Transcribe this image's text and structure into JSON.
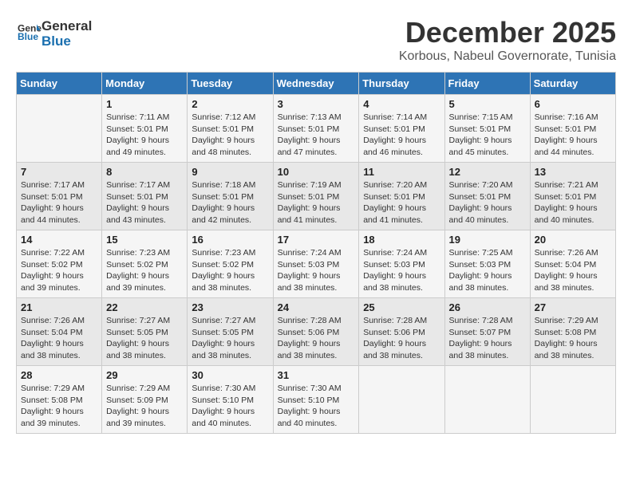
{
  "logo": {
    "general": "General",
    "blue": "Blue"
  },
  "title": {
    "month": "December 2025",
    "location": "Korbous, Nabeul Governorate, Tunisia"
  },
  "headers": [
    "Sunday",
    "Monday",
    "Tuesday",
    "Wednesday",
    "Thursday",
    "Friday",
    "Saturday"
  ],
  "weeks": [
    [
      {
        "day": "",
        "info": ""
      },
      {
        "day": "1",
        "info": "Sunrise: 7:11 AM\nSunset: 5:01 PM\nDaylight: 9 hours and 49 minutes."
      },
      {
        "day": "2",
        "info": "Sunrise: 7:12 AM\nSunset: 5:01 PM\nDaylight: 9 hours and 48 minutes."
      },
      {
        "day": "3",
        "info": "Sunrise: 7:13 AM\nSunset: 5:01 PM\nDaylight: 9 hours and 47 minutes."
      },
      {
        "day": "4",
        "info": "Sunrise: 7:14 AM\nSunset: 5:01 PM\nDaylight: 9 hours and 46 minutes."
      },
      {
        "day": "5",
        "info": "Sunrise: 7:15 AM\nSunset: 5:01 PM\nDaylight: 9 hours and 45 minutes."
      },
      {
        "day": "6",
        "info": "Sunrise: 7:16 AM\nSunset: 5:01 PM\nDaylight: 9 hours and 44 minutes."
      }
    ],
    [
      {
        "day": "7",
        "info": "Sunrise: 7:17 AM\nSunset: 5:01 PM\nDaylight: 9 hours and 44 minutes."
      },
      {
        "day": "8",
        "info": "Sunrise: 7:17 AM\nSunset: 5:01 PM\nDaylight: 9 hours and 43 minutes."
      },
      {
        "day": "9",
        "info": "Sunrise: 7:18 AM\nSunset: 5:01 PM\nDaylight: 9 hours and 42 minutes."
      },
      {
        "day": "10",
        "info": "Sunrise: 7:19 AM\nSunset: 5:01 PM\nDaylight: 9 hours and 41 minutes."
      },
      {
        "day": "11",
        "info": "Sunrise: 7:20 AM\nSunset: 5:01 PM\nDaylight: 9 hours and 41 minutes."
      },
      {
        "day": "12",
        "info": "Sunrise: 7:20 AM\nSunset: 5:01 PM\nDaylight: 9 hours and 40 minutes."
      },
      {
        "day": "13",
        "info": "Sunrise: 7:21 AM\nSunset: 5:01 PM\nDaylight: 9 hours and 40 minutes."
      }
    ],
    [
      {
        "day": "14",
        "info": "Sunrise: 7:22 AM\nSunset: 5:02 PM\nDaylight: 9 hours and 39 minutes."
      },
      {
        "day": "15",
        "info": "Sunrise: 7:23 AM\nSunset: 5:02 PM\nDaylight: 9 hours and 39 minutes."
      },
      {
        "day": "16",
        "info": "Sunrise: 7:23 AM\nSunset: 5:02 PM\nDaylight: 9 hours and 38 minutes."
      },
      {
        "day": "17",
        "info": "Sunrise: 7:24 AM\nSunset: 5:03 PM\nDaylight: 9 hours and 38 minutes."
      },
      {
        "day": "18",
        "info": "Sunrise: 7:24 AM\nSunset: 5:03 PM\nDaylight: 9 hours and 38 minutes."
      },
      {
        "day": "19",
        "info": "Sunrise: 7:25 AM\nSunset: 5:03 PM\nDaylight: 9 hours and 38 minutes."
      },
      {
        "day": "20",
        "info": "Sunrise: 7:26 AM\nSunset: 5:04 PM\nDaylight: 9 hours and 38 minutes."
      }
    ],
    [
      {
        "day": "21",
        "info": "Sunrise: 7:26 AM\nSunset: 5:04 PM\nDaylight: 9 hours and 38 minutes."
      },
      {
        "day": "22",
        "info": "Sunrise: 7:27 AM\nSunset: 5:05 PM\nDaylight: 9 hours and 38 minutes."
      },
      {
        "day": "23",
        "info": "Sunrise: 7:27 AM\nSunset: 5:05 PM\nDaylight: 9 hours and 38 minutes."
      },
      {
        "day": "24",
        "info": "Sunrise: 7:28 AM\nSunset: 5:06 PM\nDaylight: 9 hours and 38 minutes."
      },
      {
        "day": "25",
        "info": "Sunrise: 7:28 AM\nSunset: 5:06 PM\nDaylight: 9 hours and 38 minutes."
      },
      {
        "day": "26",
        "info": "Sunrise: 7:28 AM\nSunset: 5:07 PM\nDaylight: 9 hours and 38 minutes."
      },
      {
        "day": "27",
        "info": "Sunrise: 7:29 AM\nSunset: 5:08 PM\nDaylight: 9 hours and 38 minutes."
      }
    ],
    [
      {
        "day": "28",
        "info": "Sunrise: 7:29 AM\nSunset: 5:08 PM\nDaylight: 9 hours and 39 minutes."
      },
      {
        "day": "29",
        "info": "Sunrise: 7:29 AM\nSunset: 5:09 PM\nDaylight: 9 hours and 39 minutes."
      },
      {
        "day": "30",
        "info": "Sunrise: 7:30 AM\nSunset: 5:10 PM\nDaylight: 9 hours and 40 minutes."
      },
      {
        "day": "31",
        "info": "Sunrise: 7:30 AM\nSunset: 5:10 PM\nDaylight: 9 hours and 40 minutes."
      },
      {
        "day": "",
        "info": ""
      },
      {
        "day": "",
        "info": ""
      },
      {
        "day": "",
        "info": ""
      }
    ]
  ]
}
